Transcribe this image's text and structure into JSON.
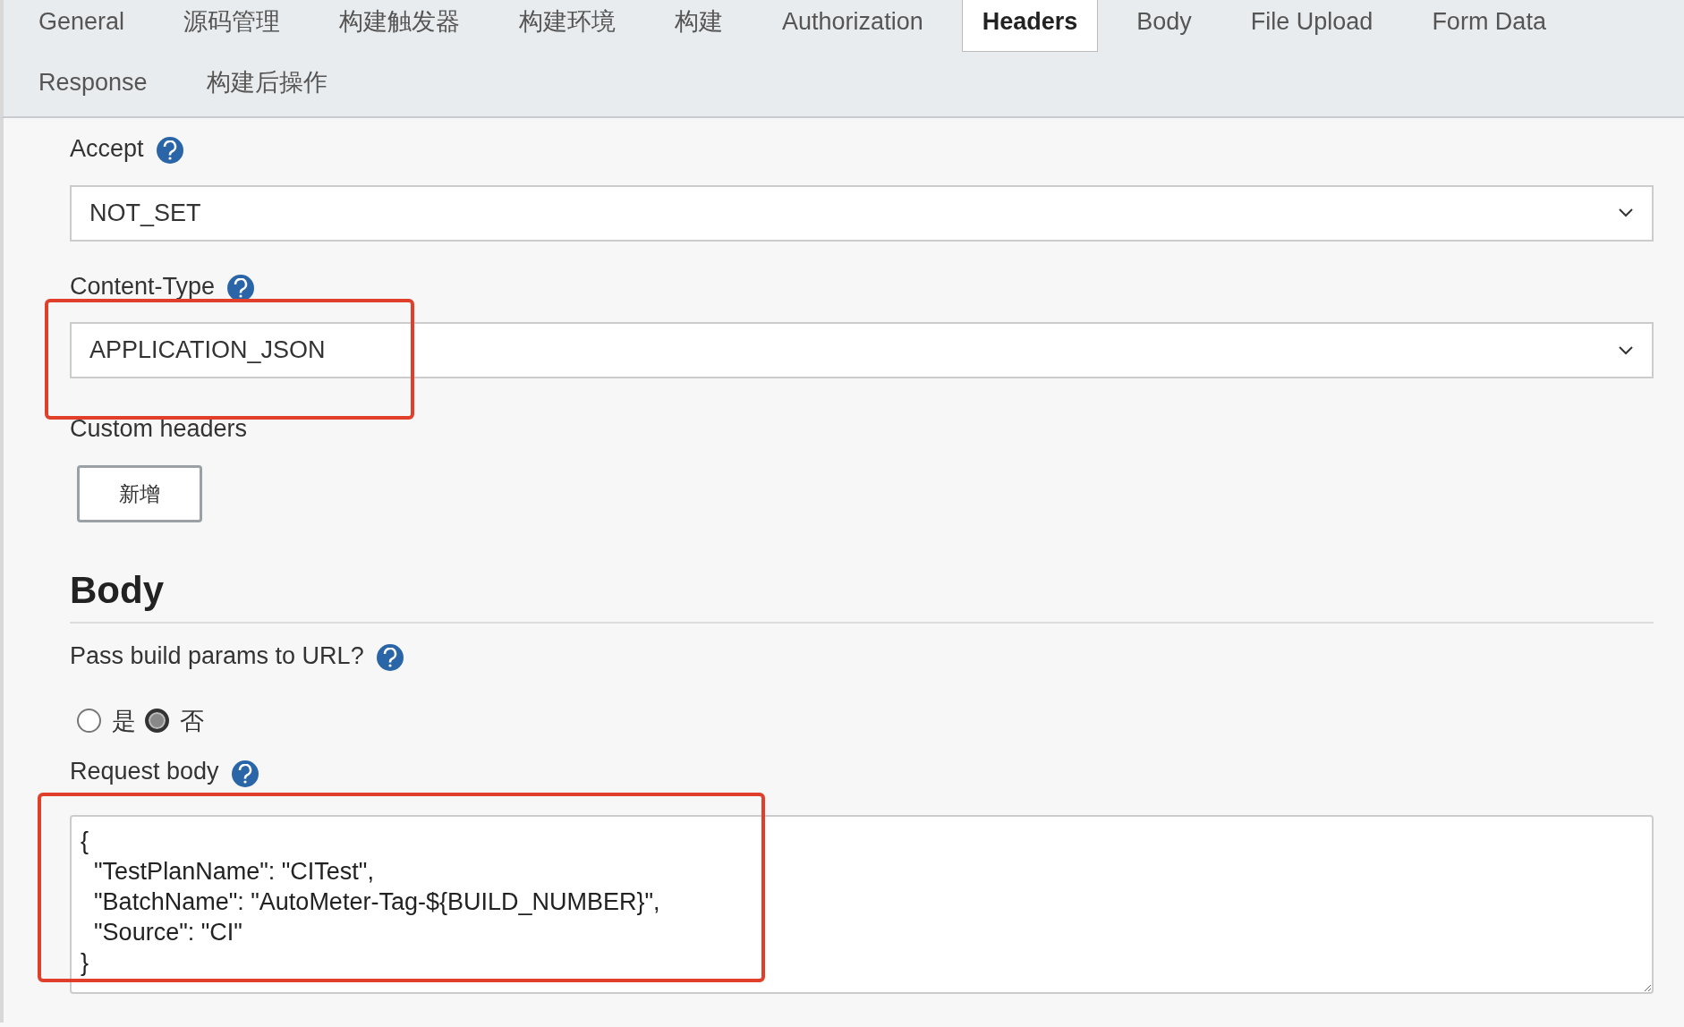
{
  "tabs": [
    {
      "label": "General",
      "selected": false
    },
    {
      "label": "源码管理",
      "selected": false
    },
    {
      "label": "构建触发器",
      "selected": false
    },
    {
      "label": "构建环境",
      "selected": false
    },
    {
      "label": "构建",
      "selected": false
    },
    {
      "label": "Authorization",
      "selected": false
    },
    {
      "label": "Headers",
      "selected": true
    },
    {
      "label": "Body",
      "selected": false
    },
    {
      "label": "File Upload",
      "selected": false
    },
    {
      "label": "Form Data",
      "selected": false
    },
    {
      "label": "Response",
      "selected": false
    },
    {
      "label": "构建后操作",
      "selected": false
    }
  ],
  "headers": {
    "accept": {
      "label": "Accept",
      "value": "NOT_SET"
    },
    "content_type": {
      "label": "Content-Type",
      "value": "APPLICATION_JSON",
      "highlighted": true
    },
    "custom_headers": {
      "label": "Custom headers",
      "button": "新增"
    }
  },
  "body": {
    "heading": "Body",
    "pass_params": {
      "label": "Pass build params to URL?",
      "options": [
        {
          "label": "是",
          "selected": false
        },
        {
          "label": "否",
          "selected": true
        }
      ]
    },
    "request_body": {
      "label": "Request body",
      "highlighted": true,
      "value": "{\n  \"TestPlanName\": \"CITest\",\n  \"BatchName\": \"AutoMeter-Tag-${BUILD_NUMBER}\",\n  \"Source\": \"CI\"\n}"
    }
  }
}
